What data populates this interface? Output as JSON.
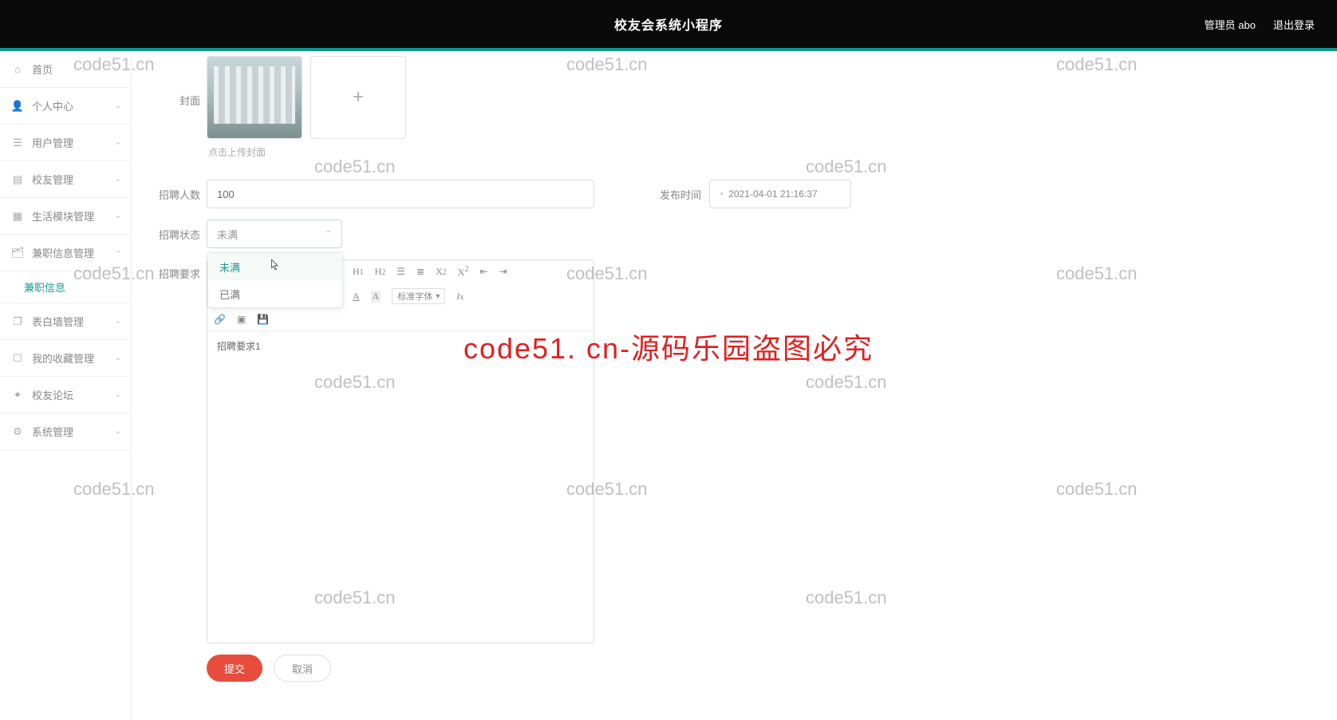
{
  "header": {
    "title": "校友会系统小程序",
    "admin": "管理员 abo",
    "logout": "退出登录"
  },
  "sidebar": {
    "home": "首页",
    "items": [
      {
        "icon": "user",
        "label": "个人中心"
      },
      {
        "icon": "users",
        "label": "用户管理"
      },
      {
        "icon": "list",
        "label": "校友管理"
      },
      {
        "icon": "grid",
        "label": "生活模块管理"
      },
      {
        "icon": "briefcase",
        "label": "兼职信息管理"
      },
      {
        "icon": "copy",
        "label": "表白墙管理"
      },
      {
        "icon": "chat",
        "label": "我的收藏管理"
      },
      {
        "icon": "globe",
        "label": "校友论坛"
      },
      {
        "icon": "gear",
        "label": "系统管理"
      }
    ],
    "sub": "兼职信息"
  },
  "form": {
    "cover_label": "封面",
    "upload_hint": "点击上传封面",
    "count_label": "招聘人数",
    "count_value": "100",
    "pub_label": "发布时间",
    "pub_value": "2021-04-01 21:16:37",
    "status_label": "招聘状态",
    "status_value": "未满",
    "status_options": [
      "未满",
      "已满"
    ],
    "req_label": "招聘要求",
    "editor_font": "标准字体",
    "editor_content": "招聘要求1",
    "submit": "提交",
    "cancel": "取消"
  },
  "watermark": "code51.cn",
  "watermark_big": "code51. cn-源码乐园盗图必究"
}
